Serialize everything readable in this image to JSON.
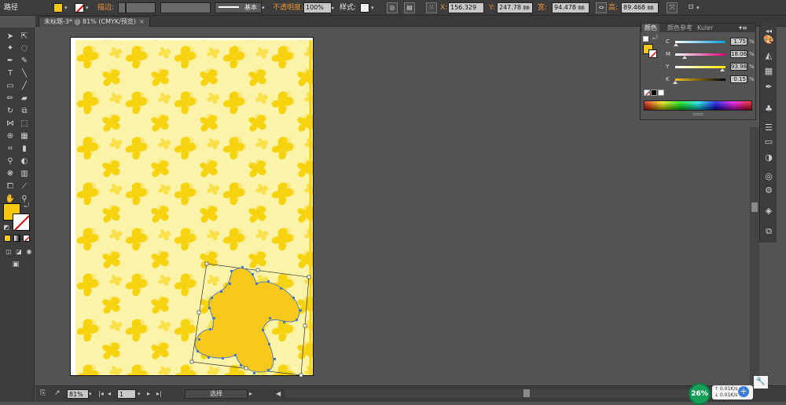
{
  "control_bar": {
    "path_label": "路径",
    "stroke_label": "描边:",
    "basic_label": "基本",
    "opacity_label": "不透明度:",
    "opacity_value": "100%",
    "style_label": "样式:",
    "x_label": "X:",
    "x_value": "156.329",
    "y_label": "Y:",
    "y_value": "247.78 ㎜",
    "w_label": "宽:",
    "w_value": "94.478 ㎜",
    "h_label": "高:",
    "h_value": "89.468 ㎜",
    "fill_color": "#f9c813"
  },
  "document": {
    "tab_title": "未标题-3* @ 81% (CMYK/预览)",
    "close": "×"
  },
  "color_panel": {
    "tabs": [
      "颜色",
      "颜色参考",
      "Kuler"
    ],
    "channels": [
      {
        "label": "C",
        "value": "1.75",
        "fraction": 0.0175,
        "gradient": "linear-gradient(to right,#ffffff,#00a0e0)"
      },
      {
        "label": "M",
        "value": "18.06",
        "fraction": 0.1806,
        "gradient": "linear-gradient(to right,#ffffff,#e0007a)"
      },
      {
        "label": "Y",
        "value": "93.98",
        "fraction": 0.9398,
        "gradient": "linear-gradient(to right,#ffffff,#ffe600)"
      },
      {
        "label": "K",
        "value": "0.15",
        "fraction": 0.0015,
        "gradient": "linear-gradient(to right,#f0c020,#000000)"
      }
    ],
    "pct_symbol": "%",
    "fill_color": "#f9c813"
  },
  "status_bar": {
    "zoom": "81%",
    "page": "1",
    "mode": "选择"
  },
  "network": {
    "percent": "26%",
    "up": "0.01K/s",
    "down": "0.01K/s",
    "plus": "+"
  },
  "colors": {
    "flower_dark": "#f7d20f",
    "flower_light": "#fbe87a",
    "background_pale": "#fbf4a8",
    "selected_fill": "#f8c81a",
    "selection_stroke": "#4a78c0"
  }
}
